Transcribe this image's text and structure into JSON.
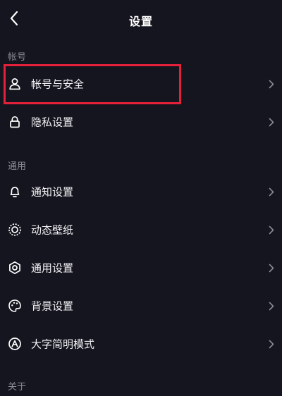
{
  "header": {
    "title": "设置",
    "back_icon": "chevron-left-icon"
  },
  "sections": [
    {
      "label": "帐号",
      "items": [
        {
          "label": "帐号与安全",
          "icon": "user-icon",
          "highlighted": true
        },
        {
          "label": "隐私设置",
          "icon": "lock-icon"
        }
      ]
    },
    {
      "label": "通用",
      "items": [
        {
          "label": "通知设置",
          "icon": "bell-icon"
        },
        {
          "label": "动态壁纸",
          "icon": "wallpaper-icon"
        },
        {
          "label": "通用设置",
          "icon": "gear-icon"
        },
        {
          "label": "背景设置",
          "icon": "palette-icon"
        },
        {
          "label": "大字简明模式",
          "icon": "text-size-icon"
        }
      ]
    },
    {
      "label": "关于",
      "items": []
    }
  ],
  "colors": {
    "background": "#15151f",
    "text": "#f2f2f5",
    "section_label": "#8b8b95",
    "chevron": "#8a8a94",
    "highlight_border": "#e5203a"
  }
}
